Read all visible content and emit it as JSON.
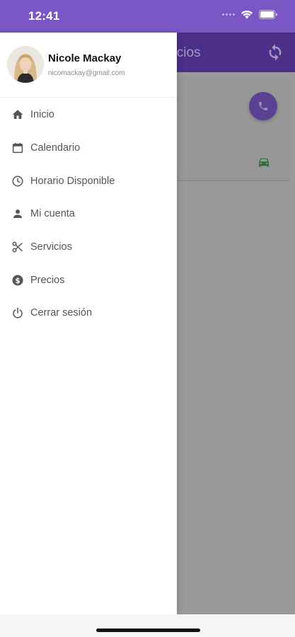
{
  "status_bar": {
    "time": "12:41",
    "background_color": "#7a57c4"
  },
  "app": {
    "title_partial": "vicios",
    "app_bar_color": "#4b2f88",
    "refresh_icon": "refresh-icon",
    "fab_icon": "phone-icon",
    "card_icon": "car-icon"
  },
  "drawer": {
    "user": {
      "name": "Nicole Mackay",
      "email": "nicomackay@gmail.com"
    },
    "items": [
      {
        "label": "Inicio",
        "icon": "home-icon"
      },
      {
        "label": "Calendario",
        "icon": "calendar-icon"
      },
      {
        "label": "Horario Disponible",
        "icon": "clock-icon"
      },
      {
        "label": "Mi cuenta",
        "icon": "person-icon"
      },
      {
        "label": "Servicios",
        "icon": "scissors-icon"
      },
      {
        "label": "Precios",
        "icon": "dollar-icon"
      },
      {
        "label": "Cerrar sesión",
        "icon": "power-icon"
      }
    ]
  }
}
